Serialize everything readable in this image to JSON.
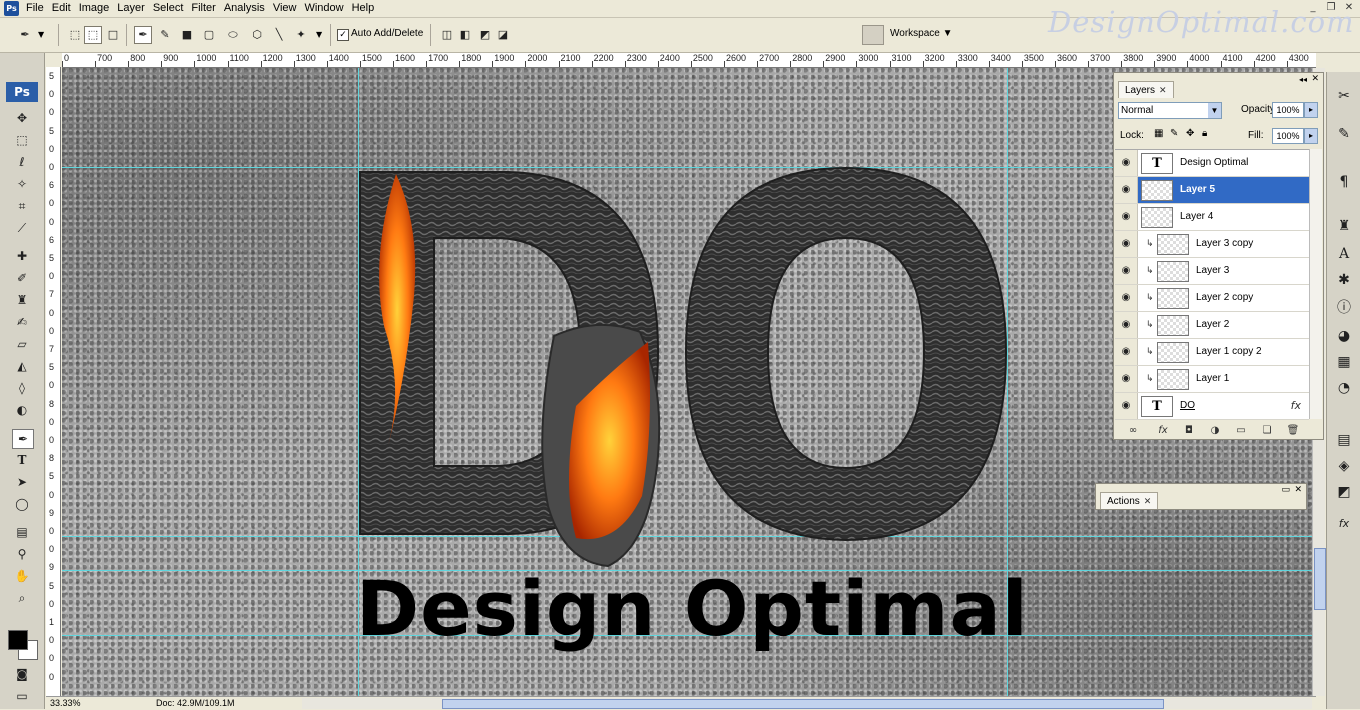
{
  "app": {
    "logo": "Ps",
    "menu": [
      "File",
      "Edit",
      "Image",
      "Layer",
      "Select",
      "Filter",
      "Analysis",
      "View",
      "Window",
      "Help"
    ],
    "watermark": "DesignOptimal.com",
    "window_buttons": [
      "_",
      "❐",
      "✕"
    ]
  },
  "options_bar": {
    "auto_add_label": "Auto Add/Delete",
    "auto_add_checked": true,
    "workspace_label": "Workspace ▼"
  },
  "tools": {
    "badge": "Ps",
    "foreground_color": "#000000",
    "background_color": "#ffffff"
  },
  "ruler": {
    "top_labels": [
      "0",
      "700",
      "800",
      "900",
      "1000",
      "1100",
      "1200",
      "1300",
      "1400",
      "1500",
      "1600",
      "1700",
      "1800",
      "1900",
      "2000",
      "2100",
      "2200",
      "2300",
      "2400",
      "2500",
      "2600",
      "2700",
      "2800",
      "2900",
      "3000",
      "3100",
      "3200",
      "3300",
      "3400",
      "3500",
      "3600",
      "3700",
      "3800",
      "3900",
      "4000",
      "4100",
      "4200",
      "4300"
    ],
    "left_labels": [
      "5",
      "0",
      "0",
      "5",
      "0",
      "0",
      "6",
      "0",
      "0",
      "6",
      "5",
      "0",
      "7",
      "0",
      "0",
      "7",
      "5",
      "0",
      "8",
      "0",
      "0",
      "8",
      "5",
      "0",
      "9",
      "0",
      "0",
      "9",
      "5",
      "0",
      "1",
      "0",
      "0",
      "0"
    ]
  },
  "canvas": {
    "headline": "DO",
    "tagline": "Design Optimal",
    "guide_color": "#5ed6dd"
  },
  "status": {
    "zoom": "33.33%",
    "doc": "Doc: 42.9M/109.1M"
  },
  "layers_panel": {
    "tab": "Layers",
    "blend_mode": "Normal",
    "opacity_label": "Opacity:",
    "opacity": "100%",
    "lock_label": "Lock:",
    "fill_label": "Fill:",
    "fill": "100%",
    "layers": [
      {
        "name": "Design Optimal",
        "kind": "text",
        "clipped": false,
        "selected": false
      },
      {
        "name": "Layer 5",
        "kind": "pixel",
        "clipped": false,
        "selected": true
      },
      {
        "name": "Layer 4",
        "kind": "pixel",
        "clipped": false,
        "selected": false
      },
      {
        "name": "Layer 3 copy",
        "kind": "pixel",
        "clipped": true,
        "selected": false
      },
      {
        "name": "Layer 3",
        "kind": "pixel",
        "clipped": true,
        "selected": false
      },
      {
        "name": "Layer 2 copy",
        "kind": "pixel",
        "clipped": true,
        "selected": false
      },
      {
        "name": "Layer 2",
        "kind": "pixel",
        "clipped": true,
        "selected": false
      },
      {
        "name": "Layer 1 copy 2",
        "kind": "pixel",
        "clipped": true,
        "selected": false
      },
      {
        "name": "Layer 1",
        "kind": "pixel",
        "clipped": true,
        "selected": false
      },
      {
        "name": "DO",
        "kind": "text",
        "clipped": false,
        "selected": false,
        "fx": "fx"
      }
    ]
  },
  "actions_panel": {
    "tab": "Actions"
  },
  "colors": {
    "selection": "#316ac5",
    "lava_orange": "#ff7a12",
    "rock_dark": "#2b2b2b"
  }
}
